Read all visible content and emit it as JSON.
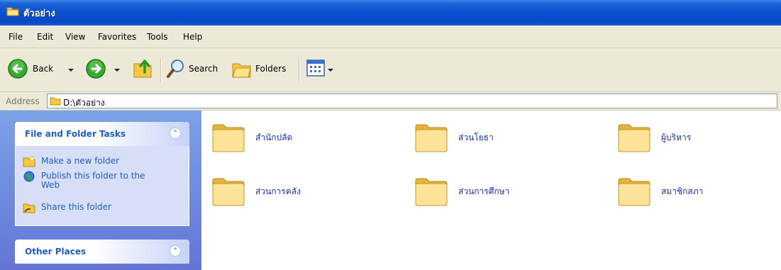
{
  "window": {
    "title": "ตัวอย่าง"
  },
  "menu": {
    "items": [
      "File",
      "Edit",
      "View",
      "Favorites",
      "Tools",
      "Help"
    ]
  },
  "toolbar": {
    "back_label": "Back",
    "search_label": "Search",
    "folders_label": "Folders"
  },
  "address": {
    "label": "Address",
    "path": "D:\\ตัวอย่าง"
  },
  "sidebar": {
    "file_tasks": {
      "title": "File and Folder Tasks",
      "items": [
        {
          "label": "Make a new folder",
          "icon": "new-folder-icon"
        },
        {
          "label": "Publish this folder to the Web",
          "icon": "globe-icon"
        },
        {
          "label": "Share this folder",
          "icon": "share-folder-icon"
        }
      ]
    },
    "other_places": {
      "title": "Other Places"
    }
  },
  "content": {
    "folders": [
      {
        "name": "สำนักปลัด"
      },
      {
        "name": "ส่วนโยธา"
      },
      {
        "name": "ผู้บริหาร"
      },
      {
        "name": "ส่วนการคลัง"
      },
      {
        "name": "ส่วนการศึกษา"
      },
      {
        "name": "สมาชิกสภา"
      }
    ]
  },
  "colors": {
    "titlebar": "#0a4fd0",
    "chrome": "#ece9d8",
    "sidebar_bg": "#7ba2e7",
    "panel_title": "#215dc6",
    "folder_label": "#1a2ea8"
  }
}
